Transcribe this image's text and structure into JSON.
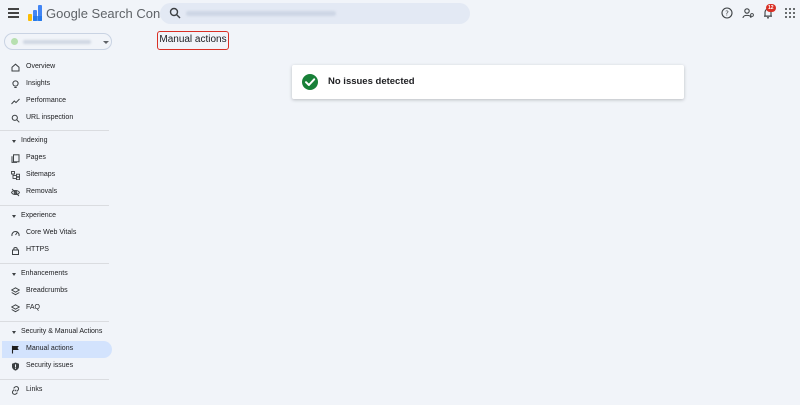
{
  "app": {
    "title": "Google Search Console",
    "notifications_count": "12"
  },
  "header": {
    "search_placeholder": ""
  },
  "page": {
    "title": "Manual actions"
  },
  "sidebar": {
    "items": [
      {
        "label": "Overview",
        "icon": "home-icon"
      },
      {
        "label": "Insights",
        "icon": "bulb-icon"
      },
      {
        "label": "Performance",
        "icon": "trending-icon"
      },
      {
        "label": "URL inspection",
        "icon": "search-icon"
      }
    ],
    "sections": [
      {
        "label": "Indexing",
        "items": [
          {
            "label": "Pages",
            "icon": "pages-icon"
          },
          {
            "label": "Sitemaps",
            "icon": "sitemap-icon"
          },
          {
            "label": "Removals",
            "icon": "eye-off-icon"
          }
        ]
      },
      {
        "label": "Experience",
        "items": [
          {
            "label": "Core Web Vitals",
            "icon": "gauge-icon"
          },
          {
            "label": "HTTPS",
            "icon": "lock-icon"
          }
        ]
      },
      {
        "label": "Enhancements",
        "items": [
          {
            "label": "Breadcrumbs",
            "icon": "layers-icon"
          },
          {
            "label": "FAQ",
            "icon": "layers-icon"
          }
        ]
      },
      {
        "label": "Security & Manual Actions",
        "items": [
          {
            "label": "Manual actions",
            "icon": "flag-icon",
            "active": true
          },
          {
            "label": "Security issues",
            "icon": "shield-icon"
          }
        ]
      }
    ],
    "footer_items": [
      {
        "label": "Links",
        "icon": "link-icon"
      }
    ]
  },
  "content": {
    "status_text": "No issues detected",
    "status_color": "#188038"
  },
  "colors": {
    "background": "#f1f4f9",
    "active_nav": "#d3e3fd",
    "highlight_border": "#d93025",
    "badge": "#d93025"
  }
}
